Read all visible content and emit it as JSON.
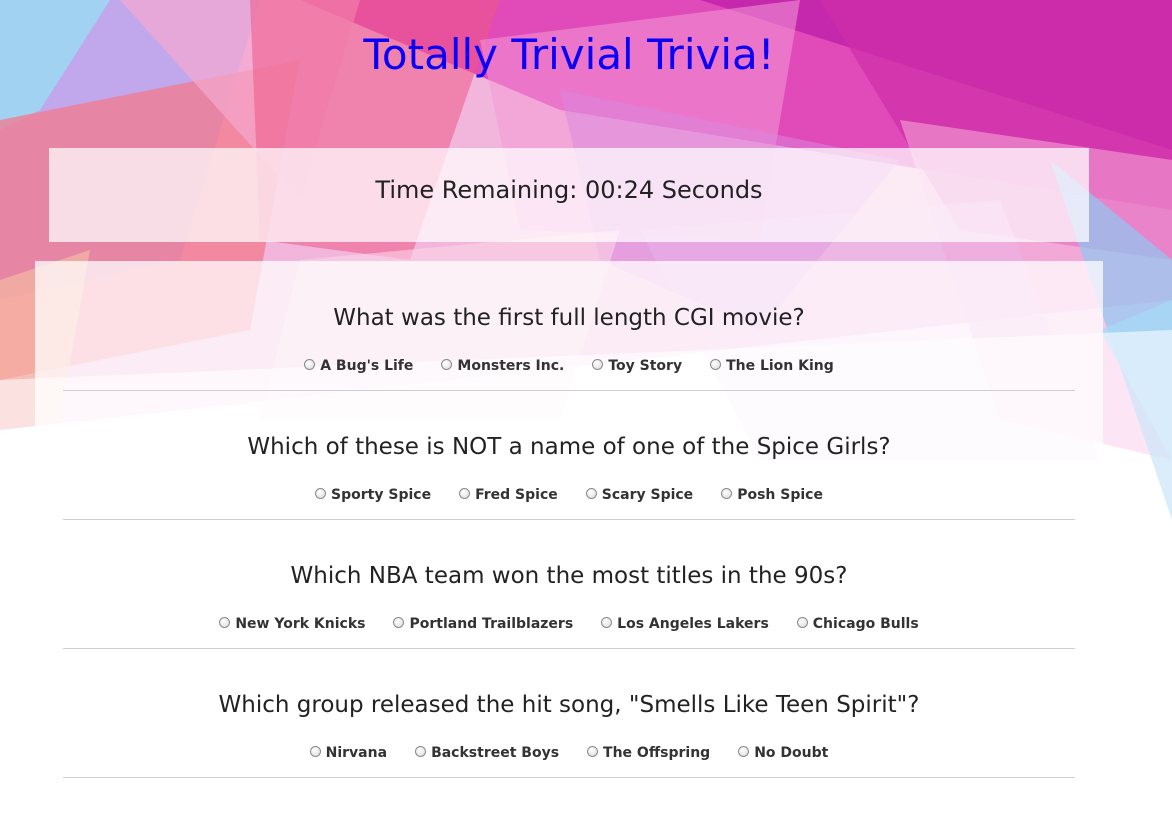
{
  "app": {
    "title": "Totally Trivial Trivia!"
  },
  "timer": {
    "text": "Time Remaining: 00:24 Seconds"
  },
  "questions": [
    {
      "text": "What was the first full length CGI movie?",
      "answers": [
        "A Bug's Life",
        "Monsters Inc.",
        "Toy Story",
        "The Lion King"
      ]
    },
    {
      "text": "Which of these is NOT a name of one of the Spice Girls?",
      "answers": [
        "Sporty Spice",
        "Fred Spice",
        "Scary Spice",
        "Posh Spice"
      ]
    },
    {
      "text": "Which NBA team won the most titles in the 90s?",
      "answers": [
        "New York Knicks",
        "Portland Trailblazers",
        "Los Angeles Lakers",
        "Chicago Bulls"
      ]
    },
    {
      "text": "Which group released the hit song, \"Smells Like Teen Spirit\"?",
      "answers": [
        "Nirvana",
        "Backstreet Boys",
        "The Offspring",
        "No Doubt"
      ]
    }
  ],
  "colors": {
    "title": "#0a00f5",
    "background_pink": "#e040b8",
    "background_magenta": "#c026b0",
    "background_coral": "#f36a7a",
    "background_lavender": "#b6a8ee"
  }
}
